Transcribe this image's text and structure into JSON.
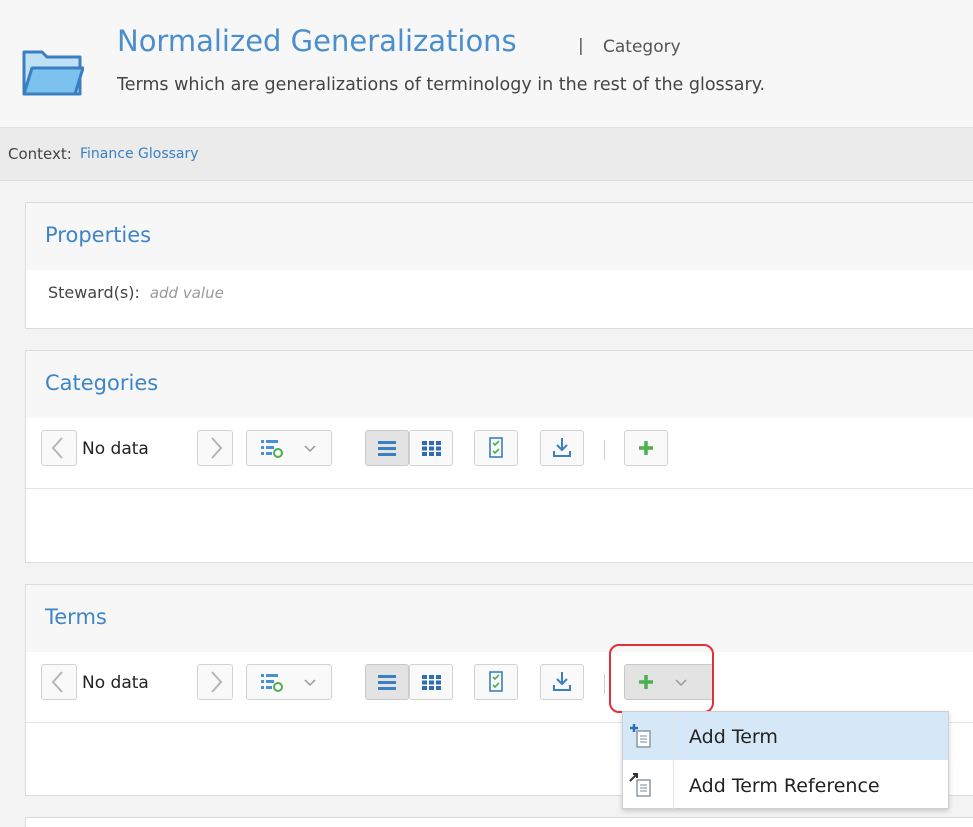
{
  "header": {
    "title": "Normalized Generalizations",
    "separator": "|",
    "type": "Category",
    "description": "Terms which are generalizations of terminology in the rest of the glossary."
  },
  "context": {
    "label": "Context:",
    "link": "Finance Glossary"
  },
  "properties": {
    "title": "Properties",
    "steward_label": "Steward(s):",
    "steward_value": "add value"
  },
  "categories": {
    "title": "Categories",
    "nodata": "No data"
  },
  "terms": {
    "title": "Terms",
    "nodata": "No data"
  },
  "add_menu": {
    "items": [
      {
        "label": "Add Term",
        "icon": "add-term-icon"
      },
      {
        "label": "Add Term Reference",
        "icon": "add-term-reference-icon"
      }
    ]
  },
  "colors": {
    "accent": "#3d85c6",
    "add_green": "#4caf50",
    "highlight_red": "#e0303a",
    "menu_selected": "#d6e8f7"
  }
}
